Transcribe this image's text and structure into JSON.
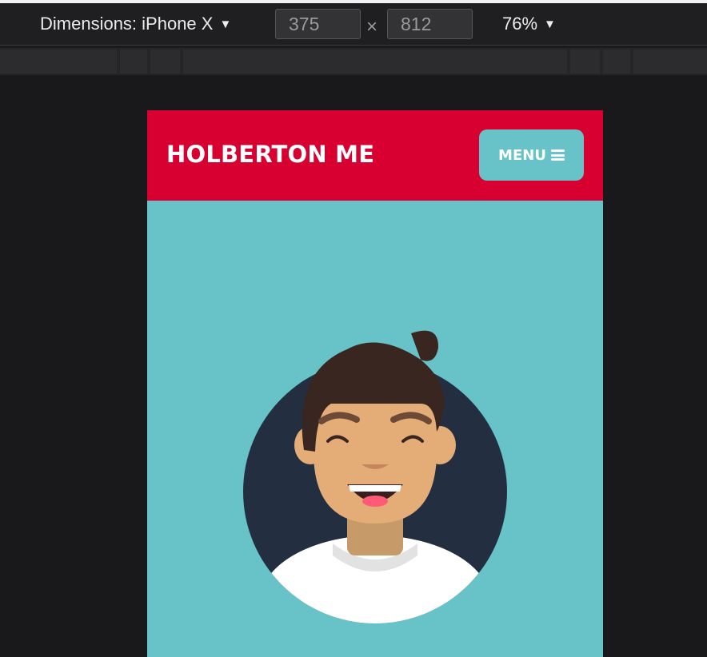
{
  "devtools": {
    "device_label": "Dimensions: iPhone X",
    "device_caret": "▼",
    "width_value": "375",
    "height_value": "812",
    "times_symbol": "×",
    "zoom_label": "76%",
    "zoom_caret": "▼"
  },
  "site": {
    "title": "HOLBERTON ME",
    "menu_label": "MENU",
    "colors": {
      "header": "#d80030",
      "accent": "#67c3c8",
      "avatar_circle": "#232f41"
    }
  },
  "icons": {
    "menu": "hamburger-icon",
    "caret": "caret-down-icon"
  }
}
